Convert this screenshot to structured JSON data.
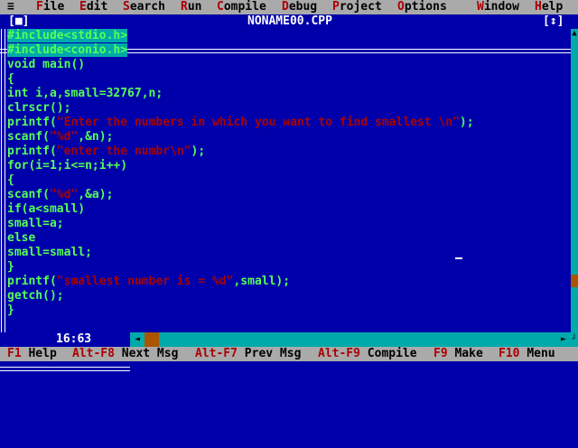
{
  "menu": {
    "system": "≡",
    "items": [
      {
        "hot": "F",
        "rest": "ile"
      },
      {
        "hot": "E",
        "rest": "dit"
      },
      {
        "hot": "S",
        "rest": "earch"
      },
      {
        "hot": "R",
        "rest": "un"
      },
      {
        "hot": "C",
        "rest": "ompile"
      },
      {
        "hot": "D",
        "rest": "ebug"
      },
      {
        "hot": "P",
        "rest": "roject"
      },
      {
        "hot": "O",
        "rest": "ptions"
      },
      {
        "hot": "W",
        "rest": "indow"
      },
      {
        "hot": "H",
        "rest": "elp"
      }
    ]
  },
  "window": {
    "title": "NONAME00.CPP",
    "close_box": "[■]",
    "zoom_box": "[↕]",
    "line_col": "16:63"
  },
  "code": [
    [
      {
        "t": "#include<stdio.h>",
        "c": "pre"
      }
    ],
    [
      {
        "t": "#include<conio.h>",
        "c": "pre"
      }
    ],
    [
      {
        "t": "void main()",
        "c": "code"
      }
    ],
    [
      {
        "t": "{",
        "c": "code"
      }
    ],
    [
      {
        "t": "int i,a,small=32767,n;",
        "c": "code"
      }
    ],
    [
      {
        "t": "clrscr();",
        "c": "code"
      }
    ],
    [
      {
        "t": "printf(",
        "c": "code"
      },
      {
        "t": "\"Enter the numbers in which you want to find smallest \\n\"",
        "c": "str"
      },
      {
        "t": ");",
        "c": "code"
      }
    ],
    [
      {
        "t": "scanf(",
        "c": "code"
      },
      {
        "t": "\"%d\"",
        "c": "str"
      },
      {
        "t": ",&n);",
        "c": "code"
      }
    ],
    [
      {
        "t": "printf(",
        "c": "code"
      },
      {
        "t": "\"enter the numbr\\n\"",
        "c": "str"
      },
      {
        "t": ");",
        "c": "code"
      }
    ],
    [
      {
        "t": "for(i=1;i<=n;i++)",
        "c": "code"
      }
    ],
    [
      {
        "t": "{",
        "c": "code"
      }
    ],
    [
      {
        "t": "scanf(",
        "c": "code"
      },
      {
        "t": "\"%d\"",
        "c": "str"
      },
      {
        "t": ",&a);",
        "c": "code"
      }
    ],
    [
      {
        "t": "if(a<small)",
        "c": "code"
      }
    ],
    [
      {
        "t": "small=a;",
        "c": "code"
      }
    ],
    [
      {
        "t": "else",
        "c": "code"
      }
    ],
    [
      {
        "t": "small=small;",
        "c": "code"
      }
    ],
    [
      {
        "t": "}",
        "c": "code"
      }
    ],
    [
      {
        "t": "printf(",
        "c": "code"
      },
      {
        "t": "\"smallest number is = %d\"",
        "c": "str"
      },
      {
        "t": ",small);",
        "c": "code"
      }
    ],
    [
      {
        "t": "getch();",
        "c": "code"
      }
    ],
    [
      {
        "t": "}",
        "c": "code"
      }
    ]
  ],
  "status": [
    {
      "key": "F1",
      "label": "Help"
    },
    {
      "key": "Alt-F8",
      "label": "Next Msg"
    },
    {
      "key": "Alt-F7",
      "label": "Prev Msg"
    },
    {
      "key": "Alt-F9",
      "label": "Compile"
    },
    {
      "key": "F9",
      "label": "Make"
    },
    {
      "key": "F10",
      "label": "Menu"
    }
  ],
  "colors": {
    "editor_bg": "#0000AA",
    "code_text": "#55FF55",
    "string_text": "#AA0000",
    "menu_bg": "#AAAAAA",
    "hotkey": "#AA0000",
    "scrollbar": "#00AAAA",
    "scroll_thumb": "#AA5500"
  },
  "icons": {
    "system_menu": "hamburger-icon",
    "close": "close-box-icon",
    "zoom": "zoom-box-icon",
    "scroll_up": "arrow-up-icon",
    "scroll_down": "arrow-down-icon",
    "scroll_left": "arrow-left-icon",
    "scroll_right": "arrow-right-icon"
  }
}
